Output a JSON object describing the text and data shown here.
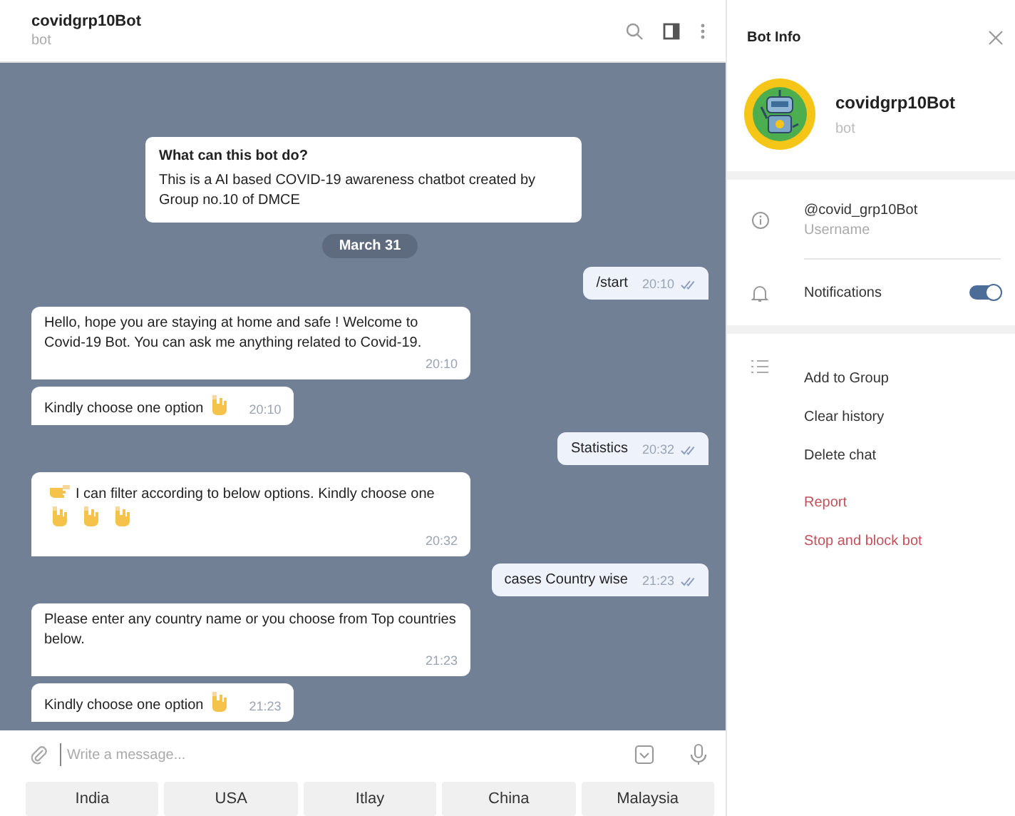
{
  "chat_header": {
    "title": "covidgrp10Bot",
    "subtitle": "bot"
  },
  "intro_card": {
    "title": "What can this bot do?",
    "text": "This is a AI based COVID-19 awareness chatbot created by Group no.10 of DMCE"
  },
  "date_label": "March 31",
  "messages": [
    {
      "outgoing": true,
      "parts": [
        {
          "kind": "text",
          "text": "/start"
        }
      ],
      "time": "20:10",
      "read": true
    },
    {
      "outgoing": false,
      "parts": [
        {
          "kind": "text",
          "text": "Hello, hope you are staying at home and safe ! Welcome to Covid-19 Bot. You can ask me anything related to Covid-19."
        }
      ],
      "time": "20:10"
    },
    {
      "outgoing": false,
      "parts": [
        {
          "kind": "text",
          "text": "Kindly choose one option"
        },
        {
          "kind": "hand_down"
        }
      ],
      "time": "20:10"
    },
    {
      "outgoing": true,
      "parts": [
        {
          "kind": "text",
          "text": "Statistics"
        }
      ],
      "time": "20:32",
      "read": true
    },
    {
      "outgoing": false,
      "parts": [
        {
          "kind": "hand_right"
        },
        {
          "kind": "text",
          "text": "I can filter according to below options. Kindly choose one"
        },
        {
          "kind": "hand_down"
        },
        {
          "kind": "hand_down"
        },
        {
          "kind": "hand_down"
        }
      ],
      "time": "20:32"
    },
    {
      "outgoing": true,
      "parts": [
        {
          "kind": "text",
          "text": "cases Country wise"
        }
      ],
      "time": "21:23",
      "read": true
    },
    {
      "outgoing": false,
      "parts": [
        {
          "kind": "text",
          "text": "Please enter any country name or you choose from Top countries below."
        }
      ],
      "time": "21:23"
    },
    {
      "outgoing": false,
      "parts": [
        {
          "kind": "text",
          "text": "Kindly choose one option"
        },
        {
          "kind": "hand_down"
        }
      ],
      "time": "21:23"
    }
  ],
  "composer": {
    "placeholder": "Write a message..."
  },
  "keyboard_buttons": [
    "India",
    "USA",
    "Itlay",
    "China",
    "Malaysia"
  ],
  "info_panel": {
    "title": "Bot Info",
    "name": "covidgrp10Bot",
    "subtitle": "bot",
    "username": "@covid_grp10Bot",
    "username_label": "Username",
    "notifications_label": "Notifications",
    "notifications_on": true,
    "actions": [
      {
        "label": "Add to Group",
        "kind": "normal"
      },
      {
        "label": "Clear history",
        "kind": "normal"
      },
      {
        "label": "Delete chat",
        "kind": "normal"
      },
      {
        "label": "Report",
        "kind": "danger"
      },
      {
        "label": "Stop and block bot",
        "kind": "danger"
      }
    ]
  }
}
